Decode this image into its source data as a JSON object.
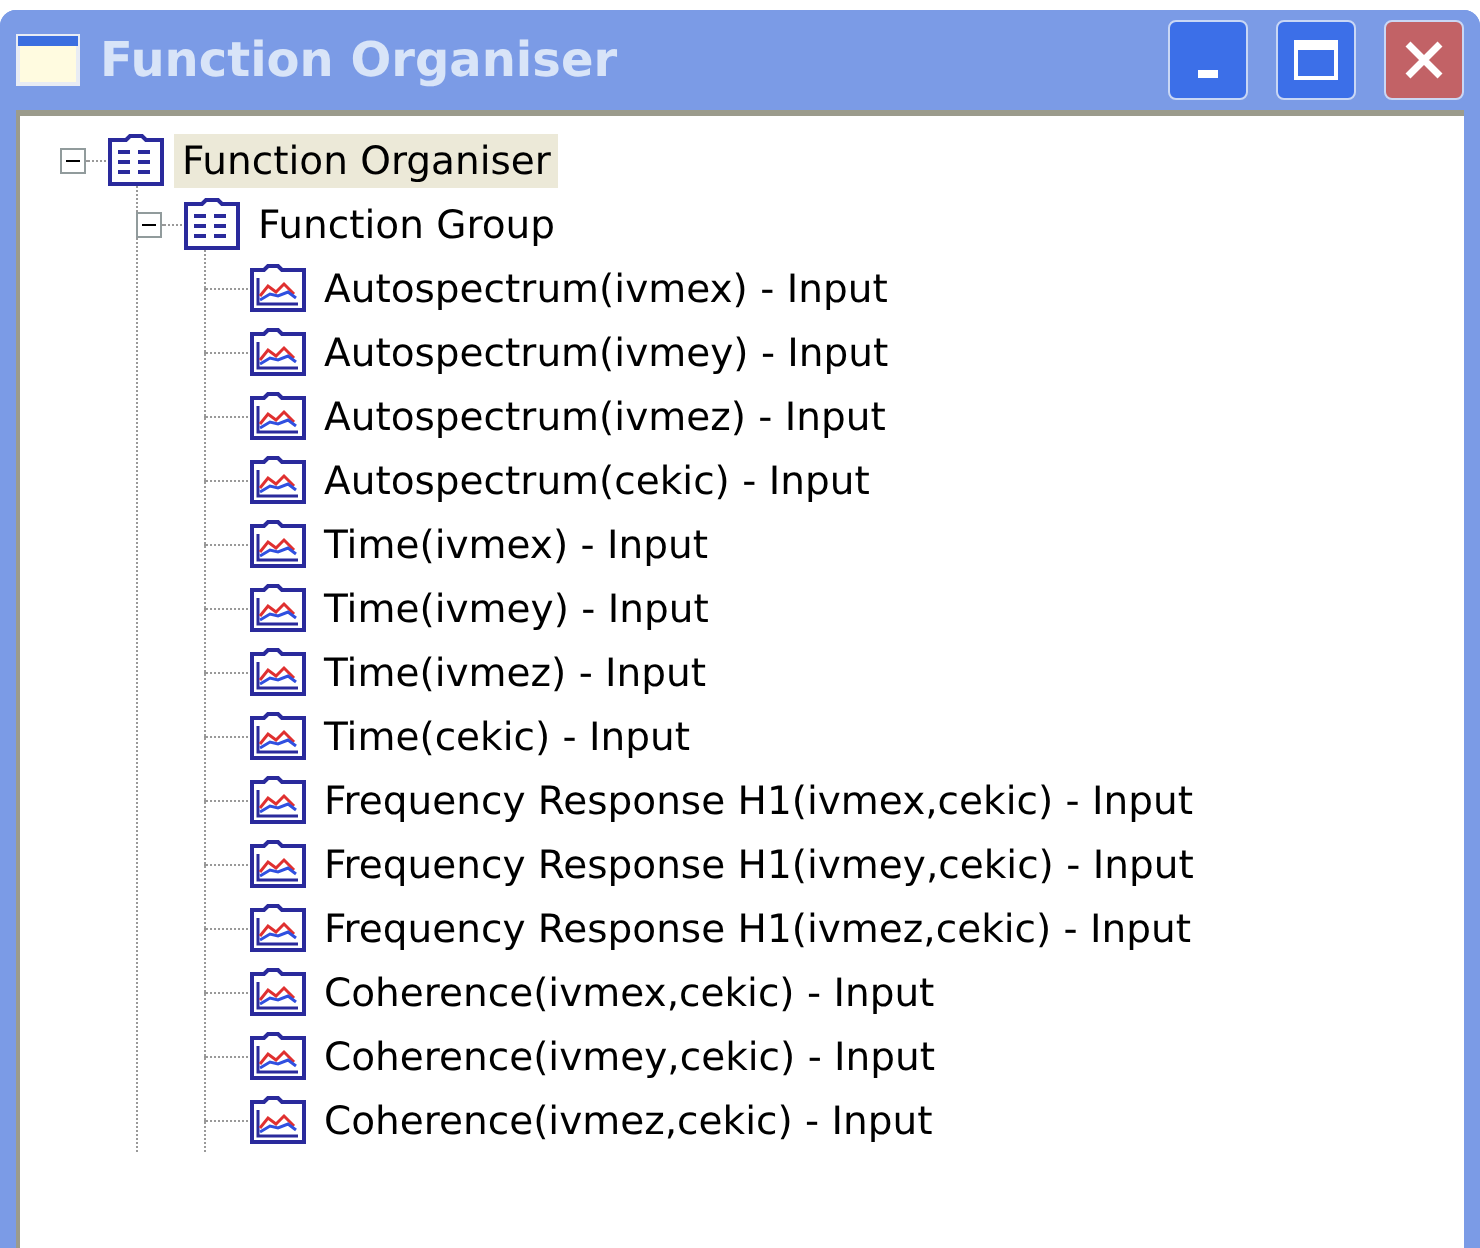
{
  "window": {
    "title": "Function Organiser",
    "active": false
  },
  "tree": [
    {
      "label": "Function Organiser",
      "kind": "organiser",
      "selected": true,
      "expanded": true,
      "children": [
        {
          "label": "Function Group",
          "kind": "group",
          "selected": false,
          "expanded": true,
          "children": [
            {
              "label": "Autospectrum(ivmex) - Input",
              "kind": "function",
              "selected": false
            },
            {
              "label": "Autospectrum(ivmey) - Input",
              "kind": "function",
              "selected": false
            },
            {
              "label": "Autospectrum(ivmez) - Input",
              "kind": "function",
              "selected": false
            },
            {
              "label": "Autospectrum(cekic) - Input",
              "kind": "function",
              "selected": false
            },
            {
              "label": "Time(ivmex) - Input",
              "kind": "function",
              "selected": false
            },
            {
              "label": "Time(ivmey) - Input",
              "kind": "function",
              "selected": false
            },
            {
              "label": "Time(ivmez) - Input",
              "kind": "function",
              "selected": false
            },
            {
              "label": "Time(cekic) - Input",
              "kind": "function",
              "selected": false
            },
            {
              "label": "Frequency Response H1(ivmex,cekic) - Input",
              "kind": "function",
              "selected": false
            },
            {
              "label": "Frequency Response H1(ivmey,cekic) - Input",
              "kind": "function",
              "selected": false
            },
            {
              "label": "Frequency Response H1(ivmez,cekic) - Input",
              "kind": "function",
              "selected": false
            },
            {
              "label": "Coherence(ivmex,cekic) - Input",
              "kind": "function",
              "selected": false
            },
            {
              "label": "Coherence(ivmey,cekic) - Input",
              "kind": "function",
              "selected": false
            },
            {
              "label": "Coherence(ivmez,cekic) - Input",
              "kind": "function",
              "selected": false
            }
          ]
        }
      ]
    }
  ]
}
